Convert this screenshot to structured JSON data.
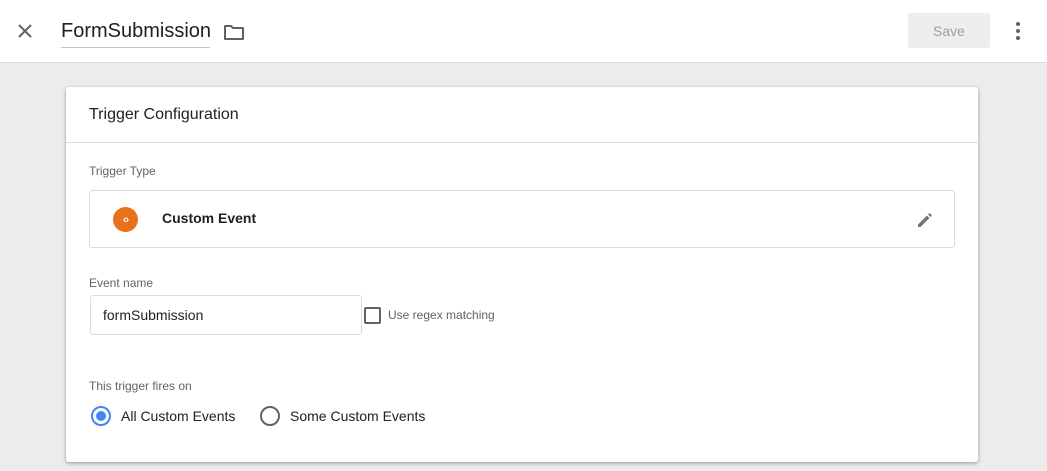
{
  "header": {
    "title": "FormSubmission",
    "save_label": "Save",
    "icons": {
      "close": "close-icon",
      "folder": "folder-icon",
      "more": "more-vert-icon"
    }
  },
  "card": {
    "title": "Trigger Configuration",
    "trigger_type": {
      "label": "Trigger Type",
      "name": "Custom Event",
      "icon": "code-brackets-icon",
      "icon_color": "#e8711a",
      "edit_icon": "pencil-icon"
    },
    "event_name": {
      "label": "Event name",
      "value": "formSubmission",
      "regex_label": "Use regex matching",
      "regex_checked": false
    },
    "fires_on": {
      "label": "This trigger fires on",
      "options": [
        {
          "label": "All Custom Events",
          "selected": true
        },
        {
          "label": "Some Custom Events",
          "selected": false
        }
      ]
    }
  },
  "colors": {
    "accent": "#4285f4",
    "background": "#ececec"
  }
}
